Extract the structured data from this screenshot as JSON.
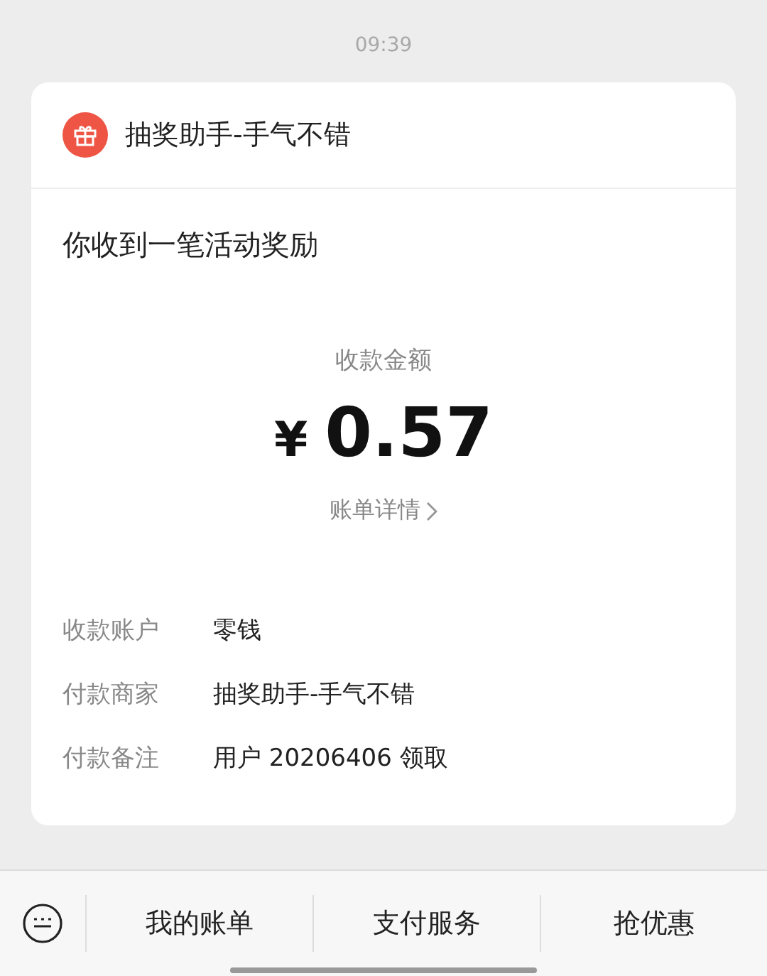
{
  "time": "09:39",
  "card": {
    "sender": "抽奖助手-手气不错",
    "title": "你收到一笔活动奖励",
    "amount_label": "收款金额",
    "currency": "¥",
    "amount": "0.57",
    "details_link": "账单详情",
    "rows": [
      {
        "label": "收款账户",
        "value": "零钱"
      },
      {
        "label": "付款商家",
        "value": "抽奖助手-手气不错"
      },
      {
        "label": "付款备注",
        "value": "用户 20206406 领取"
      }
    ]
  },
  "menu": [
    "我的账单",
    "支付服务",
    "抢优惠"
  ]
}
